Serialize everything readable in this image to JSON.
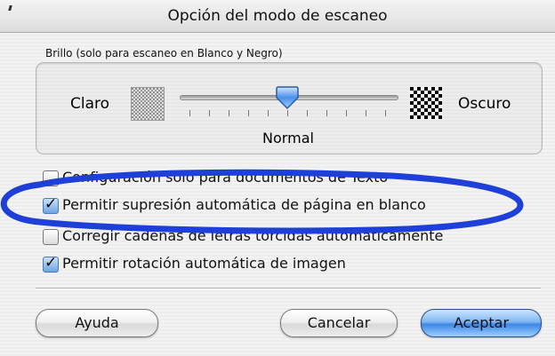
{
  "dialog": {
    "title": "Opción del modo de escaneo"
  },
  "brightness": {
    "group_label": "Brillo (solo para escaneo en Blanco y Negro)",
    "left_label": "Claro",
    "right_label": "Oscuro",
    "value_label": "Normal",
    "slider_level_fraction": 0.5,
    "tick_count": 11
  },
  "options": [
    {
      "label": "Configuración sólo para documentos de Texto",
      "checked": false
    },
    {
      "label": "Permitir supresión automática de página en blanco",
      "checked": true
    },
    {
      "label": "Corregir cadenas de letras torcidas automaticamente",
      "checked": false
    },
    {
      "label": "Permitir rotación automática de imagen",
      "checked": true
    }
  ],
  "buttons": {
    "help": "Ayuda",
    "cancel": "Cancelar",
    "ok": "Aceptar"
  },
  "colors": {
    "highlight_ellipse": "#1f3fd9",
    "default_button": "#3d86e6"
  }
}
